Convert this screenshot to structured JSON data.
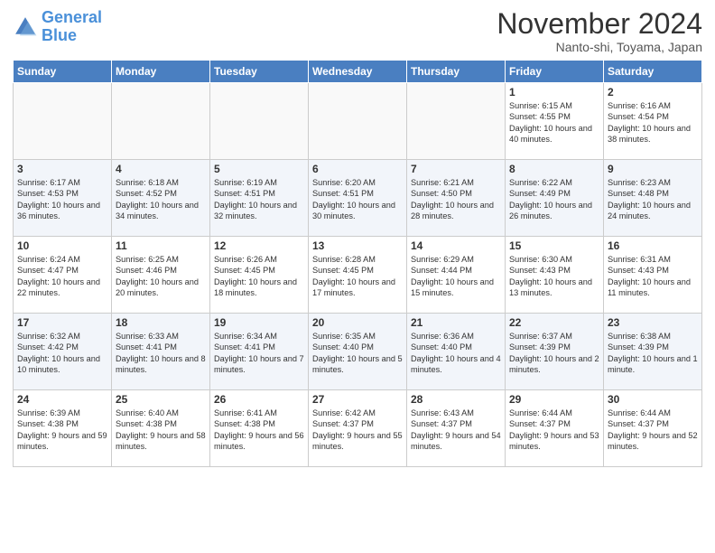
{
  "logo": {
    "line1": "General",
    "line2": "Blue"
  },
  "title": "November 2024",
  "subtitle": "Nanto-shi, Toyama, Japan",
  "weekdays": [
    "Sunday",
    "Monday",
    "Tuesday",
    "Wednesday",
    "Thursday",
    "Friday",
    "Saturday"
  ],
  "weeks": [
    [
      {
        "day": "",
        "info": ""
      },
      {
        "day": "",
        "info": ""
      },
      {
        "day": "",
        "info": ""
      },
      {
        "day": "",
        "info": ""
      },
      {
        "day": "",
        "info": ""
      },
      {
        "day": "1",
        "info": "Sunrise: 6:15 AM\nSunset: 4:55 PM\nDaylight: 10 hours and 40 minutes."
      },
      {
        "day": "2",
        "info": "Sunrise: 6:16 AM\nSunset: 4:54 PM\nDaylight: 10 hours and 38 minutes."
      }
    ],
    [
      {
        "day": "3",
        "info": "Sunrise: 6:17 AM\nSunset: 4:53 PM\nDaylight: 10 hours and 36 minutes."
      },
      {
        "day": "4",
        "info": "Sunrise: 6:18 AM\nSunset: 4:52 PM\nDaylight: 10 hours and 34 minutes."
      },
      {
        "day": "5",
        "info": "Sunrise: 6:19 AM\nSunset: 4:51 PM\nDaylight: 10 hours and 32 minutes."
      },
      {
        "day": "6",
        "info": "Sunrise: 6:20 AM\nSunset: 4:51 PM\nDaylight: 10 hours and 30 minutes."
      },
      {
        "day": "7",
        "info": "Sunrise: 6:21 AM\nSunset: 4:50 PM\nDaylight: 10 hours and 28 minutes."
      },
      {
        "day": "8",
        "info": "Sunrise: 6:22 AM\nSunset: 4:49 PM\nDaylight: 10 hours and 26 minutes."
      },
      {
        "day": "9",
        "info": "Sunrise: 6:23 AM\nSunset: 4:48 PM\nDaylight: 10 hours and 24 minutes."
      }
    ],
    [
      {
        "day": "10",
        "info": "Sunrise: 6:24 AM\nSunset: 4:47 PM\nDaylight: 10 hours and 22 minutes."
      },
      {
        "day": "11",
        "info": "Sunrise: 6:25 AM\nSunset: 4:46 PM\nDaylight: 10 hours and 20 minutes."
      },
      {
        "day": "12",
        "info": "Sunrise: 6:26 AM\nSunset: 4:45 PM\nDaylight: 10 hours and 18 minutes."
      },
      {
        "day": "13",
        "info": "Sunrise: 6:28 AM\nSunset: 4:45 PM\nDaylight: 10 hours and 17 minutes."
      },
      {
        "day": "14",
        "info": "Sunrise: 6:29 AM\nSunset: 4:44 PM\nDaylight: 10 hours and 15 minutes."
      },
      {
        "day": "15",
        "info": "Sunrise: 6:30 AM\nSunset: 4:43 PM\nDaylight: 10 hours and 13 minutes."
      },
      {
        "day": "16",
        "info": "Sunrise: 6:31 AM\nSunset: 4:43 PM\nDaylight: 10 hours and 11 minutes."
      }
    ],
    [
      {
        "day": "17",
        "info": "Sunrise: 6:32 AM\nSunset: 4:42 PM\nDaylight: 10 hours and 10 minutes."
      },
      {
        "day": "18",
        "info": "Sunrise: 6:33 AM\nSunset: 4:41 PM\nDaylight: 10 hours and 8 minutes."
      },
      {
        "day": "19",
        "info": "Sunrise: 6:34 AM\nSunset: 4:41 PM\nDaylight: 10 hours and 7 minutes."
      },
      {
        "day": "20",
        "info": "Sunrise: 6:35 AM\nSunset: 4:40 PM\nDaylight: 10 hours and 5 minutes."
      },
      {
        "day": "21",
        "info": "Sunrise: 6:36 AM\nSunset: 4:40 PM\nDaylight: 10 hours and 4 minutes."
      },
      {
        "day": "22",
        "info": "Sunrise: 6:37 AM\nSunset: 4:39 PM\nDaylight: 10 hours and 2 minutes."
      },
      {
        "day": "23",
        "info": "Sunrise: 6:38 AM\nSunset: 4:39 PM\nDaylight: 10 hours and 1 minute."
      }
    ],
    [
      {
        "day": "24",
        "info": "Sunrise: 6:39 AM\nSunset: 4:38 PM\nDaylight: 9 hours and 59 minutes."
      },
      {
        "day": "25",
        "info": "Sunrise: 6:40 AM\nSunset: 4:38 PM\nDaylight: 9 hours and 58 minutes."
      },
      {
        "day": "26",
        "info": "Sunrise: 6:41 AM\nSunset: 4:38 PM\nDaylight: 9 hours and 56 minutes."
      },
      {
        "day": "27",
        "info": "Sunrise: 6:42 AM\nSunset: 4:37 PM\nDaylight: 9 hours and 55 minutes."
      },
      {
        "day": "28",
        "info": "Sunrise: 6:43 AM\nSunset: 4:37 PM\nDaylight: 9 hours and 54 minutes."
      },
      {
        "day": "29",
        "info": "Sunrise: 6:44 AM\nSunset: 4:37 PM\nDaylight: 9 hours and 53 minutes."
      },
      {
        "day": "30",
        "info": "Sunrise: 6:44 AM\nSunset: 4:37 PM\nDaylight: 9 hours and 52 minutes."
      }
    ]
  ]
}
